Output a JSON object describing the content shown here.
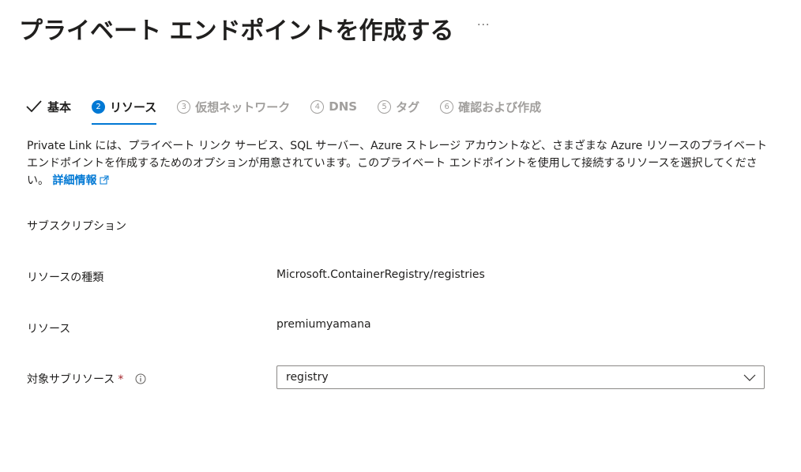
{
  "page": {
    "title": "プライベート エンドポイントを作成する",
    "more_label": "···"
  },
  "tabs": [
    {
      "step": "",
      "label": "基本",
      "state": "done",
      "icon": "check-icon"
    },
    {
      "step": "2",
      "label": "リソース",
      "state": "active"
    },
    {
      "step": "3",
      "label": "仮想ネットワーク",
      "state": "pending"
    },
    {
      "step": "4",
      "label": "DNS",
      "state": "pending"
    },
    {
      "step": "5",
      "label": "タグ",
      "state": "pending"
    },
    {
      "step": "6",
      "label": "確認および作成",
      "state": "pending"
    }
  ],
  "description": {
    "text": "Private Link には、プライベート リンク サービス、SQL サーバー、Azure ストレージ アカウントなど、さまざまな Azure リソースのプライベート エンドポイントを作成するためのオプションが用意されています。このプライベート エンドポイントを使用して接続するリソースを選択してください。",
    "link_label": "詳細情報",
    "link_icon": "external-link-icon"
  },
  "form": {
    "subscription": {
      "label": "サブスクリプション",
      "value": ""
    },
    "resource_type": {
      "label": "リソースの種類",
      "value": "Microsoft.ContainerRegistry/registries"
    },
    "resource": {
      "label": "リソース",
      "value": "premiumyamana"
    },
    "target_subresource": {
      "label": "対象サブリソース",
      "required_mark": "*",
      "info_icon": "info-icon",
      "value": "registry"
    }
  },
  "colors": {
    "accent": "#0078d4",
    "required": "#a4262c",
    "disabled_text": "#a19f9d",
    "text": "#201f1e"
  }
}
